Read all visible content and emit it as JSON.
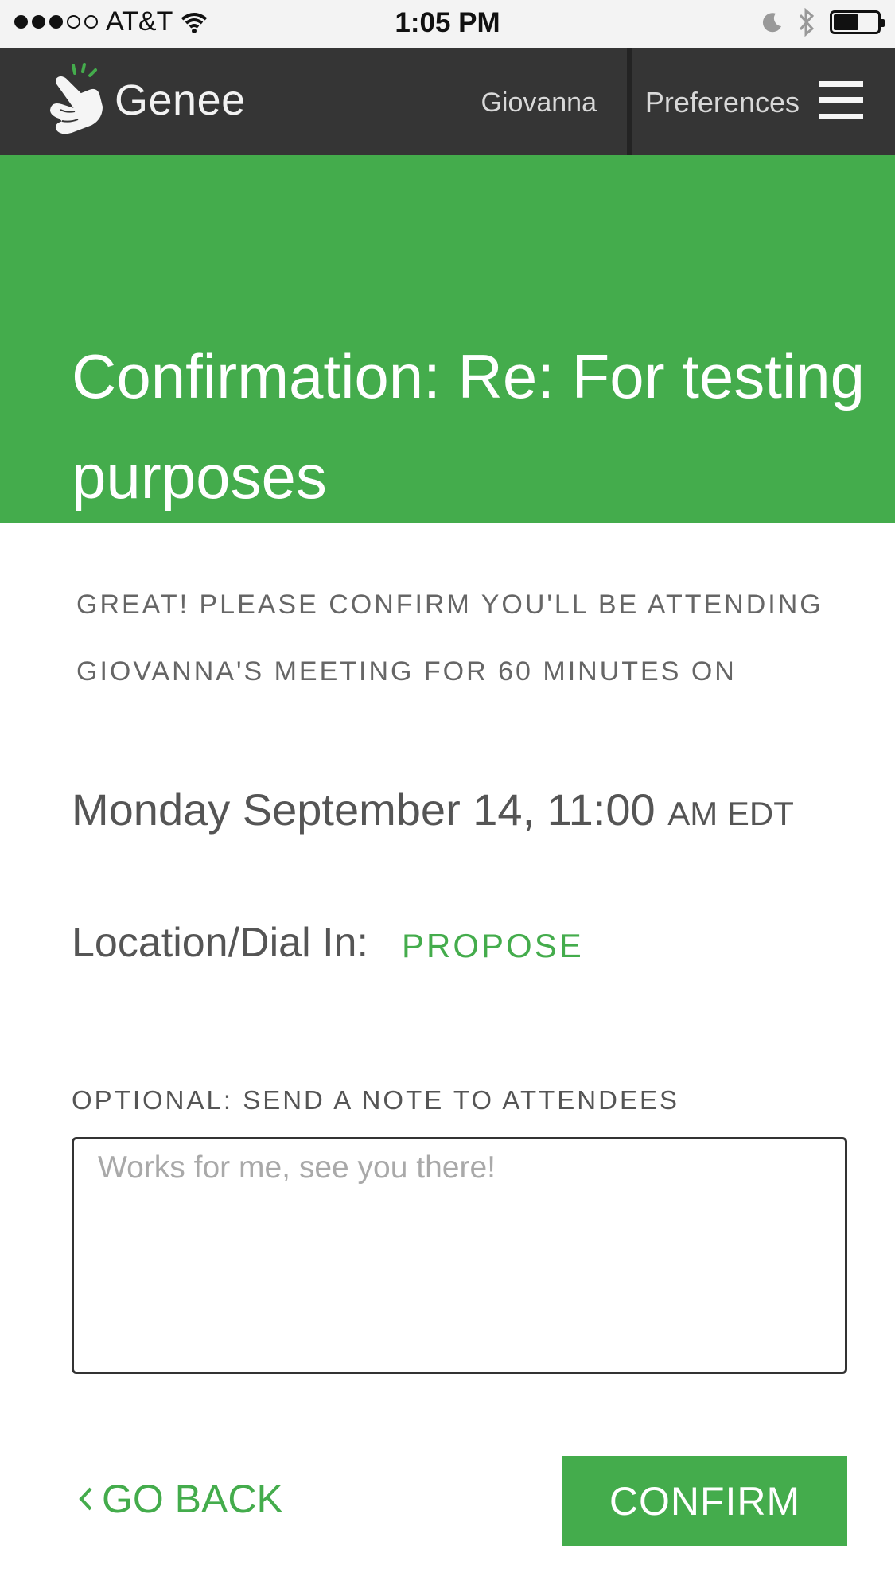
{
  "status_bar": {
    "carrier": "AT&T",
    "time": "1:05 PM",
    "battery_level": 0.6
  },
  "nav": {
    "logo_text": "Genee",
    "user_name": "Giovanna",
    "preferences_label": "Preferences"
  },
  "page": {
    "title": "Confirmation: Re: For testing purposes",
    "message": "Great! Please confirm you'll be attending Giovanna's meeting for 60 minutes on",
    "meeting_datetime": "Monday September 14, 11:00",
    "meeting_timezone": "AM EDT",
    "location_label": "Location/Dial In:",
    "propose_label": "PROPOSE",
    "note_label": "OPTIONAL: SEND A NOTE TO ATTENDEES",
    "note_placeholder": "Works for me, see you there!",
    "note_value": "",
    "go_back_label": "GO BACK",
    "confirm_label": "CONFIRM"
  },
  "colors": {
    "accent": "#44ac4c",
    "nav_bg": "#353535"
  },
  "icons": [
    "wifi-icon",
    "moon-icon",
    "bluetooth-icon",
    "battery-icon",
    "genee-hand-logo-icon",
    "hamburger-menu-icon",
    "chevron-left-icon"
  ]
}
